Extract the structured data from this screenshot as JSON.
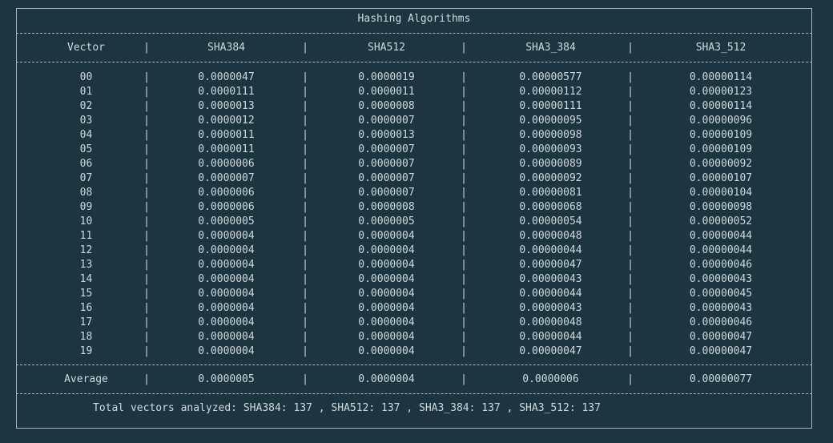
{
  "title": "Hashing Algorithms",
  "columns": [
    "Vector",
    "SHA384",
    "SHA512",
    "SHA3_384",
    "SHA3_512"
  ],
  "rows": [
    [
      "00",
      "0.0000047",
      "0.0000019",
      "0.00000577",
      "0.00000114"
    ],
    [
      "01",
      "0.0000111",
      "0.0000011",
      "0.00000112",
      "0.00000123"
    ],
    [
      "02",
      "0.0000013",
      "0.0000008",
      "0.00000111",
      "0.00000114"
    ],
    [
      "03",
      "0.0000012",
      "0.0000007",
      "0.00000095",
      "0.00000096"
    ],
    [
      "04",
      "0.0000011",
      "0.0000013",
      "0.00000098",
      "0.00000109"
    ],
    [
      "05",
      "0.0000011",
      "0.0000007",
      "0.00000093",
      "0.00000109"
    ],
    [
      "06",
      "0.0000006",
      "0.0000007",
      "0.00000089",
      "0.00000092"
    ],
    [
      "07",
      "0.0000007",
      "0.0000007",
      "0.00000092",
      "0.00000107"
    ],
    [
      "08",
      "0.0000006",
      "0.0000007",
      "0.00000081",
      "0.00000104"
    ],
    [
      "09",
      "0.0000006",
      "0.0000008",
      "0.00000068",
      "0.00000098"
    ],
    [
      "10",
      "0.0000005",
      "0.0000005",
      "0.00000054",
      "0.00000052"
    ],
    [
      "11",
      "0.0000004",
      "0.0000004",
      "0.00000048",
      "0.00000044"
    ],
    [
      "12",
      "0.0000004",
      "0.0000004",
      "0.00000044",
      "0.00000044"
    ],
    [
      "13",
      "0.0000004",
      "0.0000004",
      "0.00000047",
      "0.00000046"
    ],
    [
      "14",
      "0.0000004",
      "0.0000004",
      "0.00000043",
      "0.00000043"
    ],
    [
      "15",
      "0.0000004",
      "0.0000004",
      "0.00000044",
      "0.00000045"
    ],
    [
      "16",
      "0.0000004",
      "0.0000004",
      "0.00000043",
      "0.00000043"
    ],
    [
      "17",
      "0.0000004",
      "0.0000004",
      "0.00000048",
      "0.00000046"
    ],
    [
      "18",
      "0.0000004",
      "0.0000004",
      "0.00000044",
      "0.00000047"
    ],
    [
      "19",
      "0.0000004",
      "0.0000004",
      "0.00000047",
      "0.00000047"
    ]
  ],
  "average": [
    "Average",
    "0.0000005",
    "0.0000004",
    "0.0000006",
    "0.00000077"
  ],
  "total_line": "Total vectors analyzed: SHA384: 137 , SHA512: 137 , SHA3_384: 137 , SHA3_512: 137",
  "pipe_char": "|"
}
